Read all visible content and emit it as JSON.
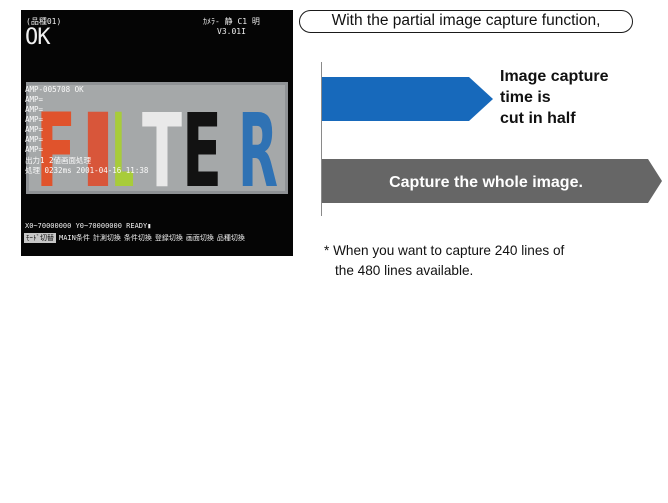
{
  "monitor": {
    "model": "(品種01)",
    "status": "OK",
    "mode": "ｶﾒﾗ- 静 C1 明",
    "version": "V3.01I",
    "image_word": "FILTER",
    "letter_colors": [
      "#e0532c",
      "#d8563a",
      "#a8cc3a",
      "#e9e9e9",
      "#121212",
      "#2f72b4"
    ],
    "overlay_rows": [
      "AMP-005708    OK",
      "AMP=",
      "AMP=",
      "AMP=",
      "AMP=",
      "AMP=",
      "AMP=",
      "出力1      2値画面処理",
      "処理  0232ms   2001-04-16 11:38"
    ],
    "coords": "X0~70000000  Y0~70000000  READY▮",
    "menu": [
      "ﾓｰﾄﾞ切替",
      "MAIN条件",
      "計測切換",
      "条件切換",
      "登録切換",
      "画面切換",
      "品種切換"
    ]
  },
  "explain": {
    "heading": "With the partial image capture function,",
    "blue_label": "Image capture\ntime is\ncut in half",
    "gray_label": "Capture the whole image.",
    "footnote_line1": "* When you want to capture 240 lines of",
    "footnote_line2": "the 480 lines available.",
    "blue_color": "#1769bb",
    "gray_color": "#666666"
  }
}
